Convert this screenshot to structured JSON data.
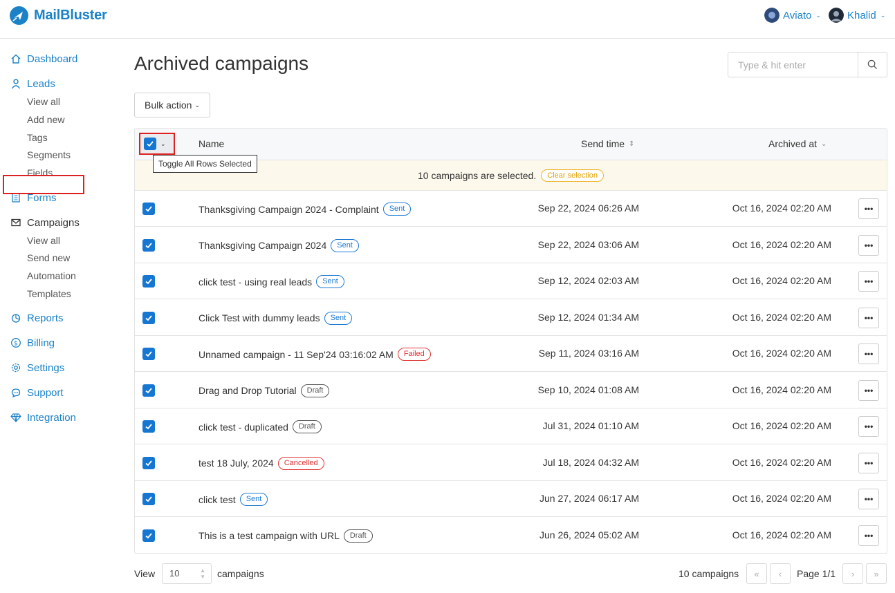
{
  "app": {
    "name": "MailBluster"
  },
  "accounts": [
    {
      "label": "Aviato"
    },
    {
      "label": "Khalid"
    }
  ],
  "sidebar": {
    "dashboard": "Dashboard",
    "leads": "Leads",
    "leads_sub": [
      "View all",
      "Add new",
      "Tags",
      "Segments",
      "Fields"
    ],
    "forms": "Forms",
    "campaigns": "Campaigns",
    "campaigns_sub": [
      "View all",
      "Send new",
      "Automation",
      "Templates"
    ],
    "reports": "Reports",
    "billing": "Billing",
    "settings": "Settings",
    "support": "Support",
    "integration": "Integration"
  },
  "main": {
    "title": "Archived campaigns",
    "search_placeholder": "Type & hit enter",
    "bulk_action": "Bulk action",
    "columns": {
      "name": "Name",
      "send_time": "Send time",
      "archived_at": "Archived at"
    },
    "tooltip": "Toggle All Rows Selected",
    "selection_text": "10 campaigns are selected.",
    "clear_selection": "Clear selection",
    "rows": [
      {
        "name": "Thanksgiving Campaign 2024 - Complaint",
        "status": "Sent",
        "send": "Sep 22, 2024 06:26 AM",
        "archived": "Oct 16, 2024 02:20 AM"
      },
      {
        "name": "Thanksgiving Campaign 2024",
        "status": "Sent",
        "send": "Sep 22, 2024 03:06 AM",
        "archived": "Oct 16, 2024 02:20 AM"
      },
      {
        "name": "click test - using real leads",
        "status": "Sent",
        "send": "Sep 12, 2024 02:03 AM",
        "archived": "Oct 16, 2024 02:20 AM"
      },
      {
        "name": "Click Test with dummy leads",
        "status": "Sent",
        "send": "Sep 12, 2024 01:34 AM",
        "archived": "Oct 16, 2024 02:20 AM"
      },
      {
        "name": "Unnamed campaign - 11 Sep'24 03:16:02 AM",
        "status": "Failed",
        "send": "Sep 11, 2024 03:16 AM",
        "archived": "Oct 16, 2024 02:20 AM"
      },
      {
        "name": "Drag and Drop Tutorial",
        "status": "Draft",
        "send": "Sep 10, 2024 01:08 AM",
        "archived": "Oct 16, 2024 02:20 AM"
      },
      {
        "name": "click test - duplicated",
        "status": "Draft",
        "send": "Jul 31, 2024 01:10 AM",
        "archived": "Oct 16, 2024 02:20 AM"
      },
      {
        "name": "test 18 July, 2024",
        "status": "Cancelled",
        "send": "Jul 18, 2024 04:32 AM",
        "archived": "Oct 16, 2024 02:20 AM"
      },
      {
        "name": "click test",
        "status": "Sent",
        "send": "Jun 27, 2024 06:17 AM",
        "archived": "Oct 16, 2024 02:20 AM"
      },
      {
        "name": "This is a test campaign with URL",
        "status": "Draft",
        "send": "Jun 26, 2024 05:02 AM",
        "archived": "Oct 16, 2024 02:20 AM"
      }
    ],
    "more_label": "•••"
  },
  "footer": {
    "view": "View",
    "per_page": "10",
    "campaigns": "campaigns",
    "count": "10 campaigns",
    "page": "Page 1/1"
  },
  "colors": {
    "accent": "#1b82c8",
    "highlight": "#e02020"
  }
}
